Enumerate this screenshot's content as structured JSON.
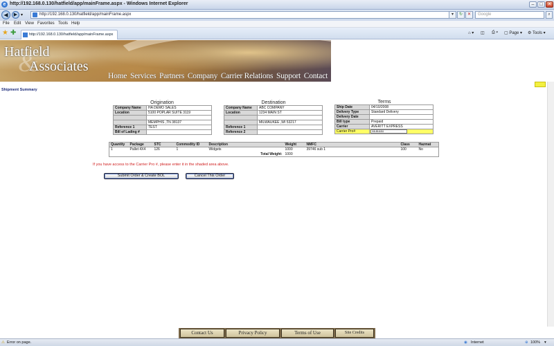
{
  "window": {
    "title": "http://192.168.0.130/hatfield/app/mainFrame.aspx - Windows Internet Explorer"
  },
  "address": {
    "url": "http://192.168.0.130/hatfield/app/mainFrame.aspx",
    "search_placeholder": "Google"
  },
  "menu": [
    "File",
    "Edit",
    "View",
    "Favorites",
    "Tools",
    "Help"
  ],
  "tab": {
    "label": "http://192.168.0.130/hatfield/app/mainFrame.aspx"
  },
  "commands": {
    "page": "Page",
    "tools": "Tools"
  },
  "banner": {
    "logo_line1": "Hatfield",
    "logo_line2": "Associates",
    "nav": [
      "Home",
      "Services",
      "Partners",
      "Company",
      "Carrier Relations",
      "Support",
      "Contact"
    ]
  },
  "heading": "Shipment Summary",
  "origination": {
    "title": "Origination",
    "company_name_label": "Company Name",
    "company_name": "HA DEMO SALES",
    "location_label": "Location",
    "address1": "5100 POPLAR SUITE 3119",
    "address2": "",
    "city": "MEMPHIS ,TN 38137",
    "ref1_label": "Reference 1",
    "ref1": "TEST",
    "bol_label": "Bill of Lading #",
    "bol": ""
  },
  "destination": {
    "title": "Destination",
    "company_name_label": "Company Name",
    "company_name": "ABC COMPANY",
    "location_label": "Location",
    "address1": "1234 MAIN ST",
    "address2": "",
    "city": "MILWAUKEE ,WI 53217",
    "ref1_label": "Reference 1",
    "ref1": "",
    "ref2_label": "Reference 2",
    "ref2": ""
  },
  "terms": {
    "title": "Terms",
    "ship_date_label": "Ship Date",
    "ship_date": "04/10/2008",
    "delivery_type_label": "Delivery Type",
    "delivery_type": "Standard Delivery",
    "delivery_date_label": "Delivery Date",
    "delivery_date": "",
    "bill_type_label": "Bill type",
    "bill_type": "Prepaid",
    "carrier_label": "Carrier",
    "carrier": "AVERITT EXPRESS",
    "carrier_pro_label": "Carrier Pro#",
    "carrier_pro": "1111111"
  },
  "cargo": {
    "headers": [
      "Quantity",
      "Package",
      "STC",
      "Commodity ID",
      "Description",
      "Weight",
      "NMFC",
      "Class",
      "Hazmat"
    ],
    "row": [
      "1",
      "Pallet 4X4",
      "126",
      "1",
      "Widgets",
      "1000",
      "39746 sub 1",
      "100",
      "No"
    ],
    "total_label": "Total Weight:",
    "total": "1000"
  },
  "notice": "If you have access to the Carrier Pro #, please enter it in the shaded area above.",
  "buttons": {
    "submit": "Submit Order & Create BOL",
    "cancel": "Cancel This Order"
  },
  "footer": [
    "Contact Us",
    "Privacy Policy",
    "Terms of Use",
    "Site Credits"
  ],
  "status": {
    "left": "Error on page.",
    "zone": "Internet",
    "zoom": "100%"
  }
}
